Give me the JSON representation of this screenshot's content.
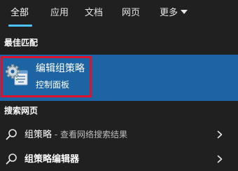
{
  "tabs": [
    {
      "label": "全部",
      "active": true
    },
    {
      "label": "应用",
      "active": false
    },
    {
      "label": "文档",
      "active": false
    },
    {
      "label": "网页",
      "active": false
    },
    {
      "label": "更多",
      "active": false,
      "dropdown": true
    }
  ],
  "sections": {
    "best_match": "最佳匹配",
    "web_search": "搜索网页"
  },
  "best_match": {
    "title": "编辑组策略",
    "subtitle": "控制面板",
    "icon": "group-policy-icon"
  },
  "web_results": [
    {
      "query": "组策略",
      "suffix": " - 查看网络搜索结果",
      "icon": "search-icon"
    },
    {
      "query": "组策略编辑器",
      "suffix": "",
      "icon": "search-icon"
    }
  ],
  "colors": {
    "background": "#202020",
    "accent": "#4cc2ff",
    "selection": "#1c64a3",
    "highlight_border": "#e0102a"
  }
}
